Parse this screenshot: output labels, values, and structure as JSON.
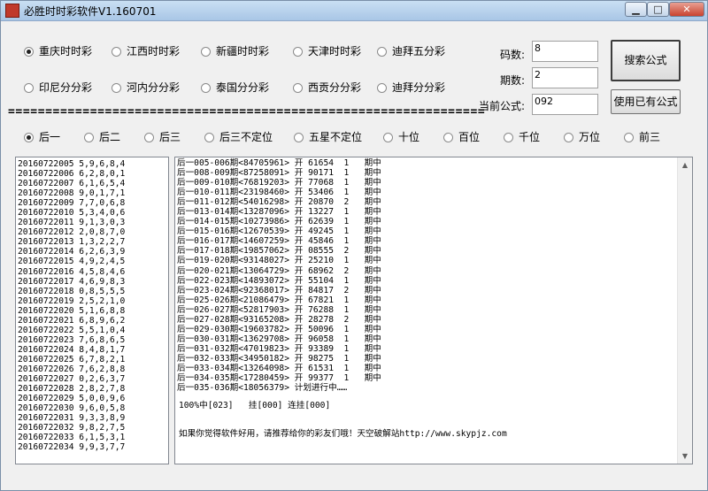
{
  "window": {
    "title": "必胜时时彩软件V1.160701",
    "min_label": "▁",
    "max_label": "□",
    "close_label": "✕"
  },
  "lottery_types": [
    {
      "label": "重庆时时彩",
      "checked": true
    },
    {
      "label": "江西时时彩",
      "checked": false
    },
    {
      "label": "新疆时时彩",
      "checked": false
    },
    {
      "label": "天津时时彩",
      "checked": false
    },
    {
      "label": "迪拜五分彩",
      "checked": false
    },
    {
      "label": "印尼分分彩",
      "checked": false
    },
    {
      "label": "河内分分彩",
      "checked": false
    },
    {
      "label": "泰国分分彩",
      "checked": false
    },
    {
      "label": "西贡分分彩",
      "checked": false
    },
    {
      "label": "迪拜分分彩",
      "checked": false
    }
  ],
  "params": {
    "code_count_label": "码数:",
    "code_count_value": "8",
    "period_count_label": "期数:",
    "period_count_value": "2",
    "current_formula_label": "当前公式:",
    "current_formula_value": "092"
  },
  "buttons": {
    "search_formula": "搜索公式",
    "use_existing_formula": "使用已有公式"
  },
  "separator": "================================================================",
  "positions": [
    {
      "label": "后一",
      "checked": true
    },
    {
      "label": "后二",
      "checked": false
    },
    {
      "label": "后三",
      "checked": false
    },
    {
      "label": "后三不定位",
      "checked": false
    },
    {
      "label": "五星不定位",
      "checked": false
    },
    {
      "label": "十位",
      "checked": false
    },
    {
      "label": "百位",
      "checked": false
    },
    {
      "label": "千位",
      "checked": false
    },
    {
      "label": "万位",
      "checked": false
    },
    {
      "label": "前三",
      "checked": false
    }
  ],
  "history": [
    "20160722005 5,9,6,8,4",
    "20160722006 6,2,8,0,1",
    "20160722007 6,1,6,5,4",
    "20160722008 9,0,1,7,1",
    "20160722009 7,7,0,6,8",
    "20160722010 5,3,4,0,6",
    "20160722011 9,1,3,0,3",
    "20160722012 2,0,8,7,0",
    "20160722013 1,3,2,2,7",
    "20160722014 6,2,6,3,9",
    "20160722015 4,9,2,4,5",
    "20160722016 4,5,8,4,6",
    "20160722017 4,6,9,8,3",
    "20160722018 0,8,5,5,5",
    "20160722019 2,5,2,1,0",
    "20160722020 5,1,6,8,8",
    "20160722021 6,8,9,6,2",
    "20160722022 5,5,1,0,4",
    "20160722023 7,6,8,6,5",
    "20160722024 8,4,8,1,7",
    "20160722025 6,7,8,2,1",
    "20160722026 7,6,2,8,8",
    "20160722027 0,2,6,3,7",
    "20160722028 2,8,2,7,8",
    "20160722029 5,0,0,9,6",
    "20160722030 9,6,0,5,8",
    "20160722031 9,3,3,8,9",
    "20160722032 9,8,2,7,5",
    "20160722033 6,1,5,3,1",
    "20160722034 9,9,3,7,7"
  ],
  "results": [
    "后一005-006期<84705961> 开 61654  1   期中",
    "后一008-009期<87258091> 开 90171  1   期中",
    "后一009-010期<76819203> 开 77068  1   期中",
    "后一010-011期<23198460> 开 53406  1   期中",
    "后一011-012期<54016298> 开 20870  2   期中",
    "后一013-014期<13287096> 开 13227  1   期中",
    "后一014-015期<10273986> 开 62639  1   期中",
    "后一015-016期<12670539> 开 49245  1   期中",
    "后一016-017期<14607259> 开 45846  1   期中",
    "后一017-018期<19857062> 开 08555  2   期中",
    "后一019-020期<93148027> 开 25210  1   期中",
    "后一020-021期<13064729> 开 68962  2   期中",
    "后一022-023期<14893072> 开 55104  1   期中",
    "后一023-024期<92368017> 开 84817  2   期中",
    "后一025-026期<21086479> 开 67821  1   期中",
    "后一026-027期<52817903> 开 76288  1   期中",
    "后一027-028期<93165208> 开 28278  2   期中",
    "后一029-030期<19603782> 开 50096  1   期中",
    "后一030-031期<13629708> 开 96058  1   期中",
    "后一031-032期<47019823> 开 93389  1   期中",
    "后一032-033期<34950182> 开 98275  1   期中",
    "后一033-034期<13264098> 开 61531  1   期中",
    "后一034-035期<17280459> 开 99377  1   期中",
    "后一035-036期<18056379> 计划进行中……"
  ],
  "summary": "100%中[023]   挂[000] 连挂[000]",
  "footer": "如果你觉得软件好用，请推荐给你的彩友们哦！天空破解站http://www.skypjz.com"
}
